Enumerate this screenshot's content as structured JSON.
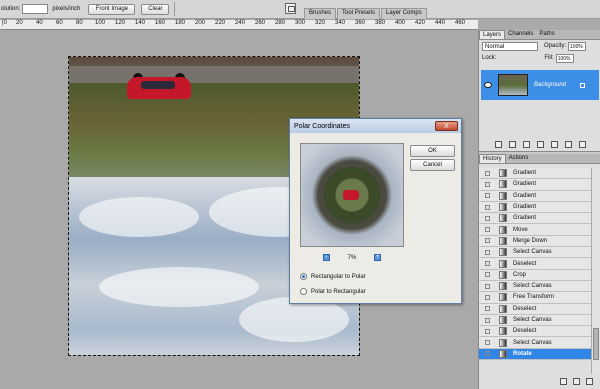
{
  "options": {
    "resolution_label": "olution:",
    "resolution_value": "",
    "units": "pixels/inch",
    "front_image": "Front Image",
    "clear": "Clear"
  },
  "well_tabs": [
    "Brushes",
    "Tool Presets",
    "Layer Comps"
  ],
  "ruler": [
    "|0",
    "20",
    "40",
    "60",
    "80",
    "100",
    "120",
    "140",
    "160",
    "180",
    "200",
    "220",
    "240",
    "260",
    "280",
    "300",
    "320",
    "340",
    "360",
    "380",
    "400",
    "420",
    "440",
    "460"
  ],
  "dialog": {
    "title": "Polar Coordinates",
    "close": "X",
    "ok": "OK",
    "cancel": "Cancel",
    "zoom": "7%",
    "zoom_minus": "-",
    "zoom_plus": "+",
    "opt1": "Rectangular to Polar",
    "opt2": "Polar to Rectangular",
    "selected": "opt1"
  },
  "layers": {
    "tabs": [
      "Layers",
      "Channels",
      "Paths"
    ],
    "blend": "Normal",
    "opacity_label": "Opacity:",
    "opacity": "100%",
    "lock_label": "Lock:",
    "fill_label": "Fill:",
    "fill": "100%",
    "layer_name": "Background"
  },
  "history": {
    "tabs": [
      "History",
      "Actions"
    ],
    "items": [
      "Gradient",
      "Gradient",
      "Gradient",
      "Gradient",
      "Gradient",
      "Move",
      "Merge Down",
      "Select Canvas",
      "Deselect",
      "Crop",
      "Select Canvas",
      "Free Transform",
      "Deselect",
      "Select Canvas",
      "Deselect",
      "Select Canvas",
      "Rotate"
    ],
    "selected_index": 16
  }
}
